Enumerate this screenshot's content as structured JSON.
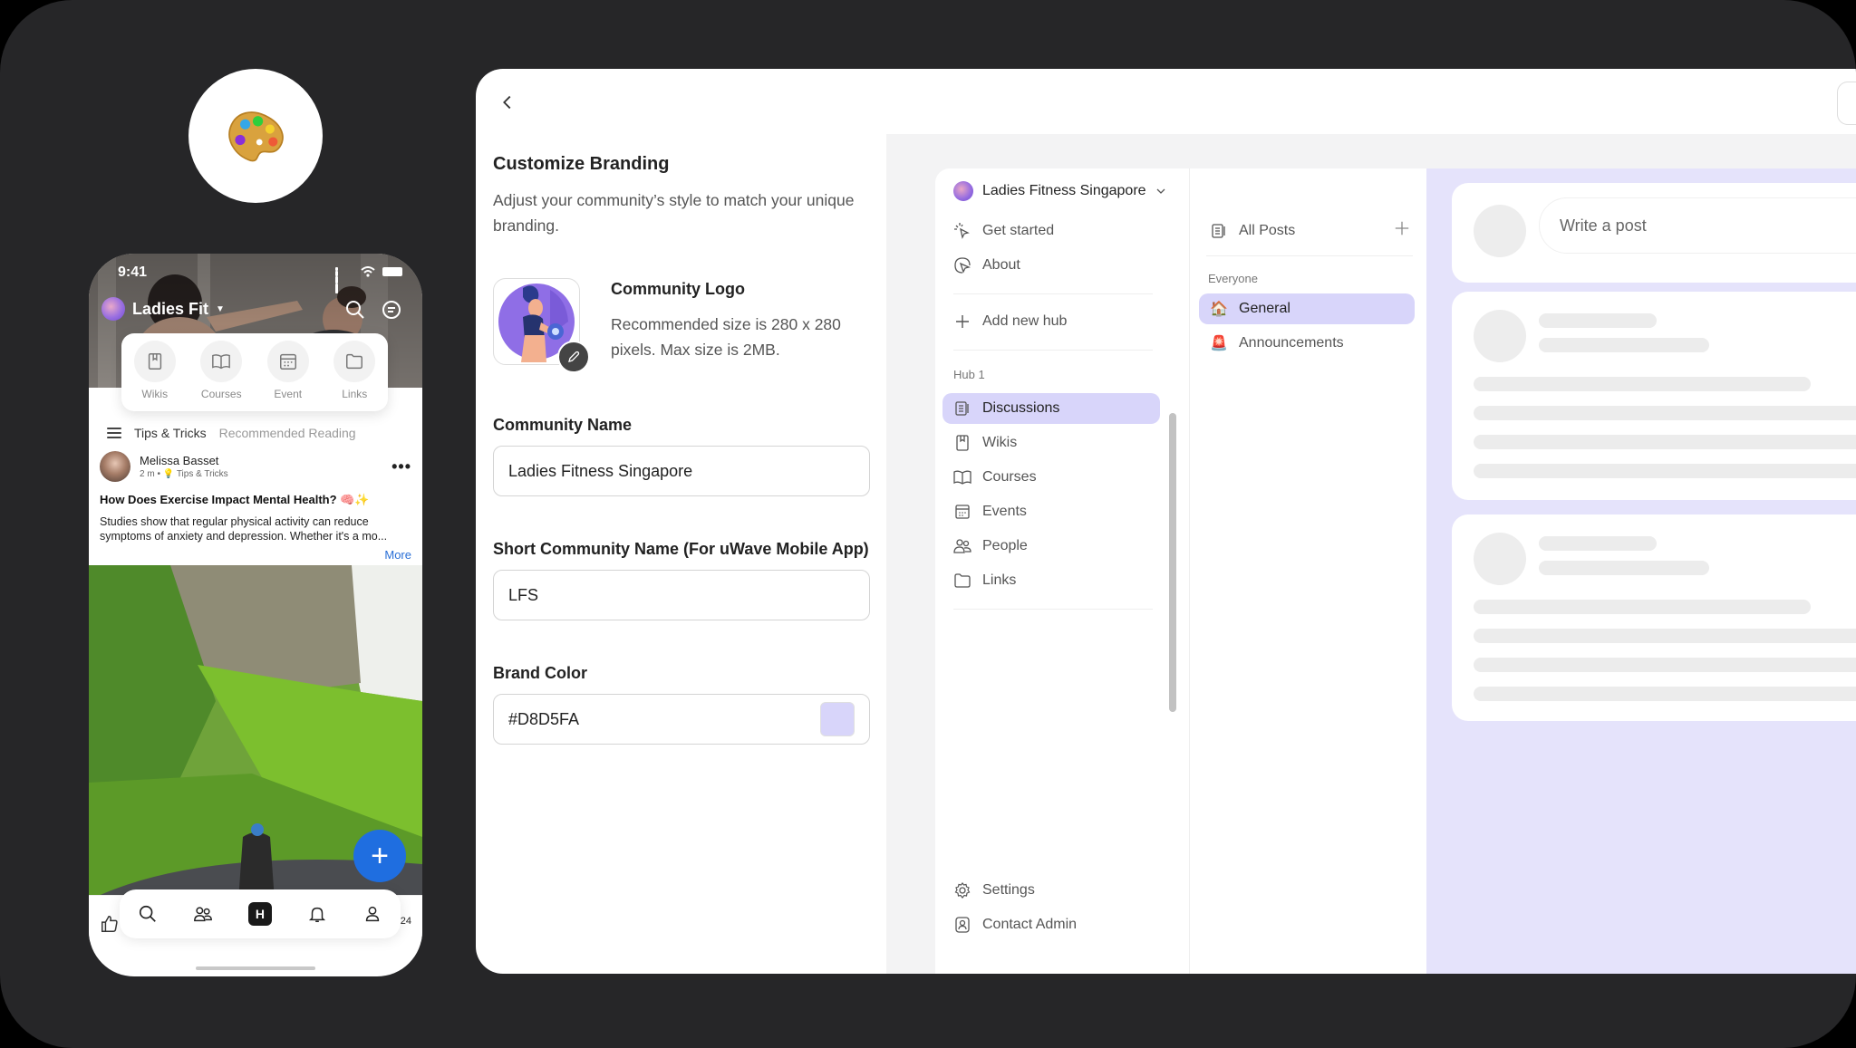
{
  "badge": {
    "icon": "artist-palette-icon"
  },
  "phone": {
    "status_time": "9:41",
    "app_title": "Ladies Fit",
    "quick_links": [
      {
        "label": "Wikis",
        "icon": "bookmark-book-icon"
      },
      {
        "label": "Courses",
        "icon": "open-book-icon"
      },
      {
        "label": "Event",
        "icon": "calendar-icon"
      },
      {
        "label": "Links",
        "icon": "folder-icon"
      }
    ],
    "tabs": [
      "Tips & Tricks",
      "Recommended Reading"
    ],
    "post": {
      "author": "Melissa Basset",
      "time": "2 m",
      "separator": "•",
      "category": "Tips & Tricks",
      "title": "How Does Exercise Impact Mental Health? 🧠✨",
      "body": "Studies show that regular physical activity can reduce symptoms of anxiety and depression. Whether it's a mo...",
      "more_label": "More",
      "share_count": "24"
    },
    "fab_label": "+",
    "bottom_nav": [
      {
        "name": "search",
        "icon": "search-icon"
      },
      {
        "name": "people",
        "icon": "people-icon"
      },
      {
        "name": "home",
        "label": "H",
        "icon": "home-hub-icon"
      },
      {
        "name": "notifications",
        "icon": "bell-icon"
      },
      {
        "name": "profile",
        "icon": "user-icon"
      }
    ]
  },
  "branding": {
    "title": "Customize Branding",
    "subtitle": "Adjust your community’s style to match your unique branding.",
    "logo": {
      "title": "Community Logo",
      "description": "Recommended size is 280 x 280 pixels. Max size is 2MB."
    },
    "community_name": {
      "label": "Community Name",
      "value": "Ladies Fitness Singapore"
    },
    "short_name": {
      "label": "Short Community Name (For uWave Mobile App)",
      "value": "LFS"
    },
    "brand_color": {
      "label": "Brand Color",
      "value": "#D8D5FA",
      "swatch": "#D8D5FA"
    }
  },
  "preview": {
    "community_name": "Ladies Fitness Singapore",
    "sidebar": {
      "top_items": [
        {
          "label": "Get started",
          "icon": "sparkle-cursor-icon"
        },
        {
          "label": "About",
          "icon": "cursor-bubble-icon"
        }
      ],
      "add_hub_label": "Add new hub",
      "hub_section": "Hub 1",
      "hub_items": [
        {
          "label": "Discussions",
          "icon": "discussion-icon",
          "active": true
        },
        {
          "label": "Wikis",
          "icon": "bookmark-book-icon"
        },
        {
          "label": "Courses",
          "icon": "open-book-icon"
        },
        {
          "label": "Events",
          "icon": "calendar-icon"
        },
        {
          "label": "People",
          "icon": "people-icon"
        },
        {
          "label": "Links",
          "icon": "folder-icon"
        }
      ],
      "bottom_items": [
        {
          "label": "Settings",
          "icon": "gear-icon"
        },
        {
          "label": "Contact Admin",
          "icon": "contact-admin-icon"
        }
      ]
    },
    "channels": {
      "all_posts_label": "All Posts",
      "section": "Everyone",
      "items": [
        {
          "label": "General",
          "emoji": "🏠",
          "active": true
        },
        {
          "label": "Announcements",
          "emoji": "🚨"
        }
      ]
    },
    "feed": {
      "write_placeholder": "Write a post"
    },
    "accent_color": "#D8D5FA",
    "feed_bg_color": "#E5E3FB"
  }
}
